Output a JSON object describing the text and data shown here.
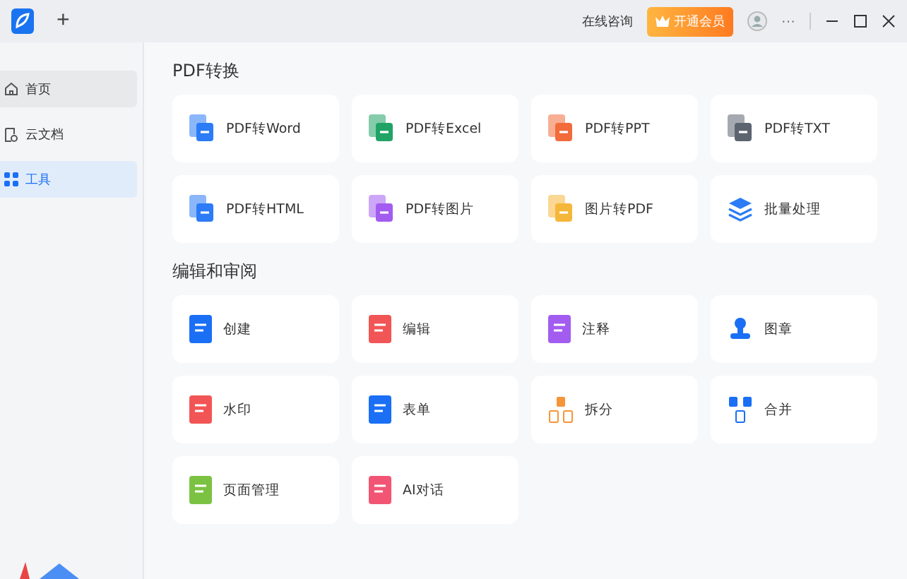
{
  "titlebar": {
    "add_tab": "+",
    "consult": "在线咨询",
    "vip_button": "开通会员",
    "more": "···"
  },
  "sidebar": {
    "items": [
      {
        "label": "首页",
        "selected": false,
        "hovered": true
      },
      {
        "label": "云文档",
        "selected": false,
        "hovered": false
      },
      {
        "label": "工具",
        "selected": true,
        "hovered": false
      }
    ]
  },
  "sections": [
    {
      "title": "PDF转换",
      "tools": [
        {
          "label": "PDF转Word",
          "kind": "convert"
        },
        {
          "label": "PDF转Excel",
          "kind": "convert"
        },
        {
          "label": "PDF转PPT",
          "kind": "convert"
        },
        {
          "label": "PDF转TXT",
          "kind": "convert"
        },
        {
          "label": "PDF转HTML",
          "kind": "convert"
        },
        {
          "label": "PDF转图片",
          "kind": "convert"
        },
        {
          "label": "图片转PDF",
          "kind": "convert"
        },
        {
          "label": "批量处理",
          "kind": "layers"
        }
      ]
    },
    {
      "title": "编辑和审阅",
      "tools": [
        {
          "label": "创建",
          "kind": "solid"
        },
        {
          "label": "编辑",
          "kind": "solid"
        },
        {
          "label": "注释",
          "kind": "solid"
        },
        {
          "label": "图章",
          "kind": "stamp"
        },
        {
          "label": "水印",
          "kind": "solid"
        },
        {
          "label": "表单",
          "kind": "solid"
        },
        {
          "label": "拆分",
          "kind": "split"
        },
        {
          "label": "合并",
          "kind": "merge"
        },
        {
          "label": "页面管理",
          "kind": "solid"
        },
        {
          "label": "AI对话",
          "kind": "solid"
        }
      ]
    }
  ]
}
